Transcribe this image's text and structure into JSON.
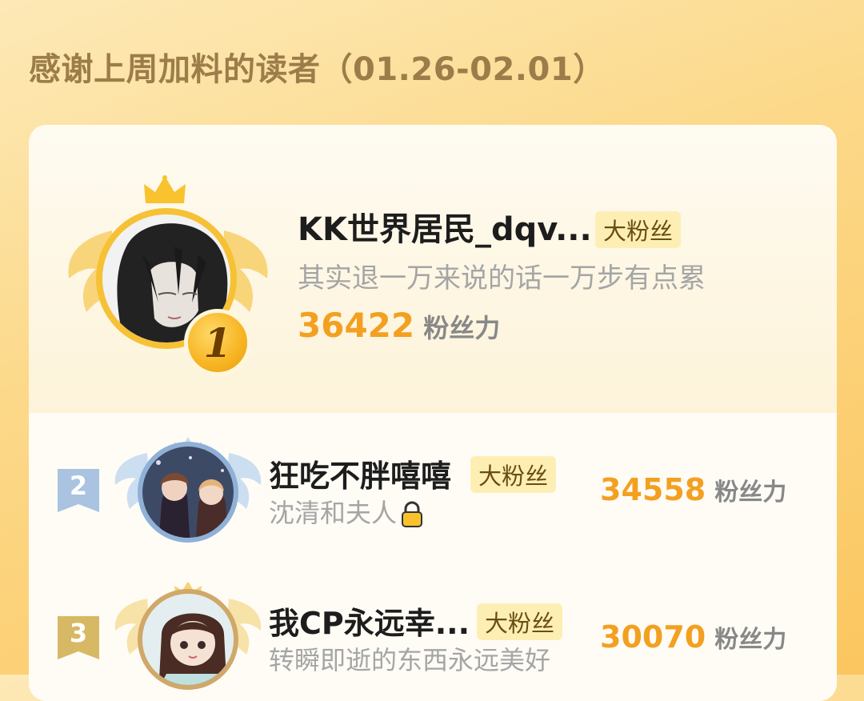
{
  "header": {
    "title": "感谢上周加料的读者（01.26-02.01）"
  },
  "colors": {
    "accent": "#f3a021",
    "badge_bg": "#fdefb4",
    "title": "#9c7d4a"
  },
  "top_fan": {
    "rank": "1",
    "name": "KK世界居民_dqv...",
    "badge": "大粉丝",
    "desc": "其实退一万来说的话一万步有点累",
    "score": "36422",
    "score_unit": "粉丝力",
    "icons": [
      "crown-icon",
      "wings-icon"
    ]
  },
  "rows": [
    {
      "rank": "2",
      "name": "狂吃不胖嘻嘻",
      "badge": "大粉丝",
      "desc": "沈清和夫人",
      "desc_icon": "lock-icon",
      "score": "34558",
      "score_unit": "粉丝力"
    },
    {
      "rank": "3",
      "name": "我CP永远幸...",
      "badge": "大粉丝",
      "desc": "转瞬即逝的东西永远美好",
      "score": "30070",
      "score_unit": "粉丝力"
    }
  ]
}
